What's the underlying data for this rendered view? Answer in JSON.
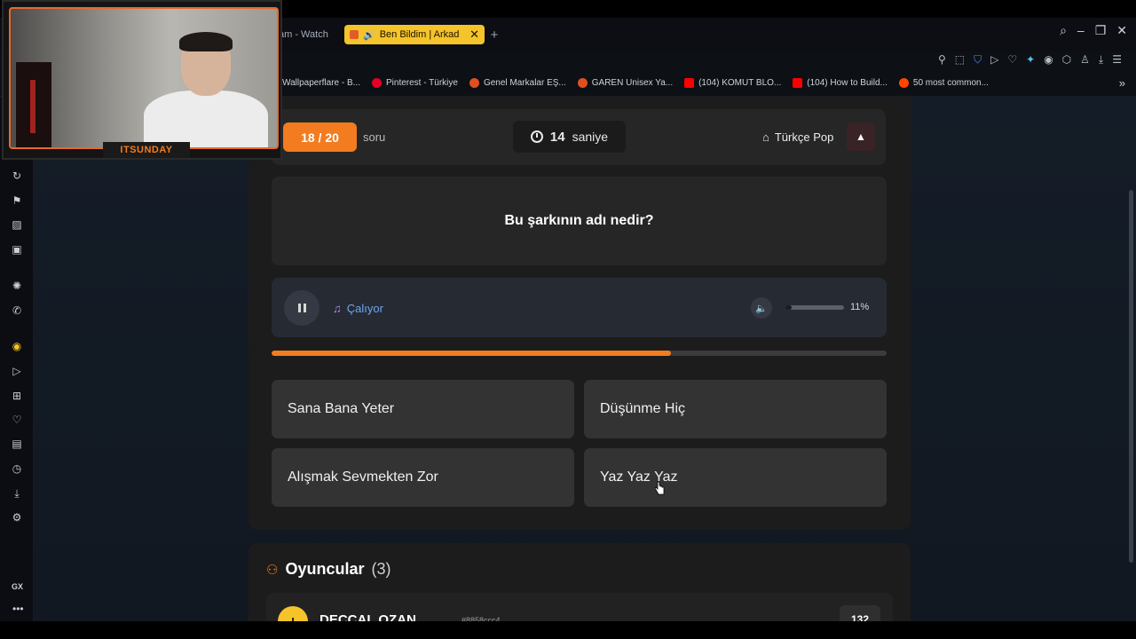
{
  "browser": {
    "prev_tab_title": "am - Watch",
    "active_tab_title": "Ben Bildim | Arkad",
    "new_tab_symbol": "+",
    "window_controls": [
      "⌕",
      "–",
      "❐",
      "✕"
    ],
    "toolbar_icons": [
      "pin-icon",
      "snapshot-icon",
      "shield-icon",
      "play-icon",
      "heart-icon",
      "ai-icon",
      "vpn-icon",
      "extensions-icon",
      "profile-icon",
      "download-icon",
      "menu-icon"
    ],
    "bookmarks": [
      {
        "label": "Wallpaperflare - B...",
        "color": "#6a6a6a"
      },
      {
        "label": "Pinterest - Türkiye",
        "color": "#e60023"
      },
      {
        "label": "Genel Markalar EŞ...",
        "color": "#e0501e"
      },
      {
        "label": "GAREN Unisex Ya...",
        "color": "#e0501e"
      },
      {
        "label": "(104) KOMUT BLO...",
        "color": "#ff0000"
      },
      {
        "label": "(104) How to Build...",
        "color": "#ff0000"
      },
      {
        "label": "50 most common...",
        "color": "#ff4500"
      }
    ],
    "bookmarks_overflow": "»"
  },
  "sidebar": {
    "items": [
      "refresh-icon",
      "gaming-icon",
      "twitch-icon",
      "mastodon-icon",
      "chatgpt-icon",
      "whatsapp-icon",
      "music-icon",
      "send-icon",
      "apps-icon",
      "heart-icon",
      "pinboard-icon",
      "history-icon",
      "download-icon",
      "settings-icon"
    ],
    "gx_label": "GX",
    "more_label": "•••"
  },
  "webcam": {
    "channel_label": "ITSUNDAY"
  },
  "quiz": {
    "counter": "18 / 20",
    "counter_suffix": "soru",
    "timer_value": "14",
    "timer_unit": "saniye",
    "category": "Türkçe Pop",
    "report_symbol": "▲",
    "question": "Bu şarkının adı nedir?",
    "player_status": "Çalıyor",
    "volume_percent": "11%",
    "volume_level": 0.11,
    "progress_level": 0.65,
    "answers": [
      "Sana Bana Yeter",
      "Düşünme Hiç",
      "Alışmak Sevmekten Zor",
      "Yaz Yaz Yaz"
    ]
  },
  "players": {
    "title": "Oyuncular",
    "count": "(3)",
    "first_player": {
      "initial": "I",
      "name": "DECCAL OZAN",
      "tag": "#8858ccc4",
      "score": "132"
    }
  },
  "colors": {
    "accent": "#f27c1f",
    "active_tab": "#f5c32a",
    "playing_text": "#6ea6f2"
  }
}
